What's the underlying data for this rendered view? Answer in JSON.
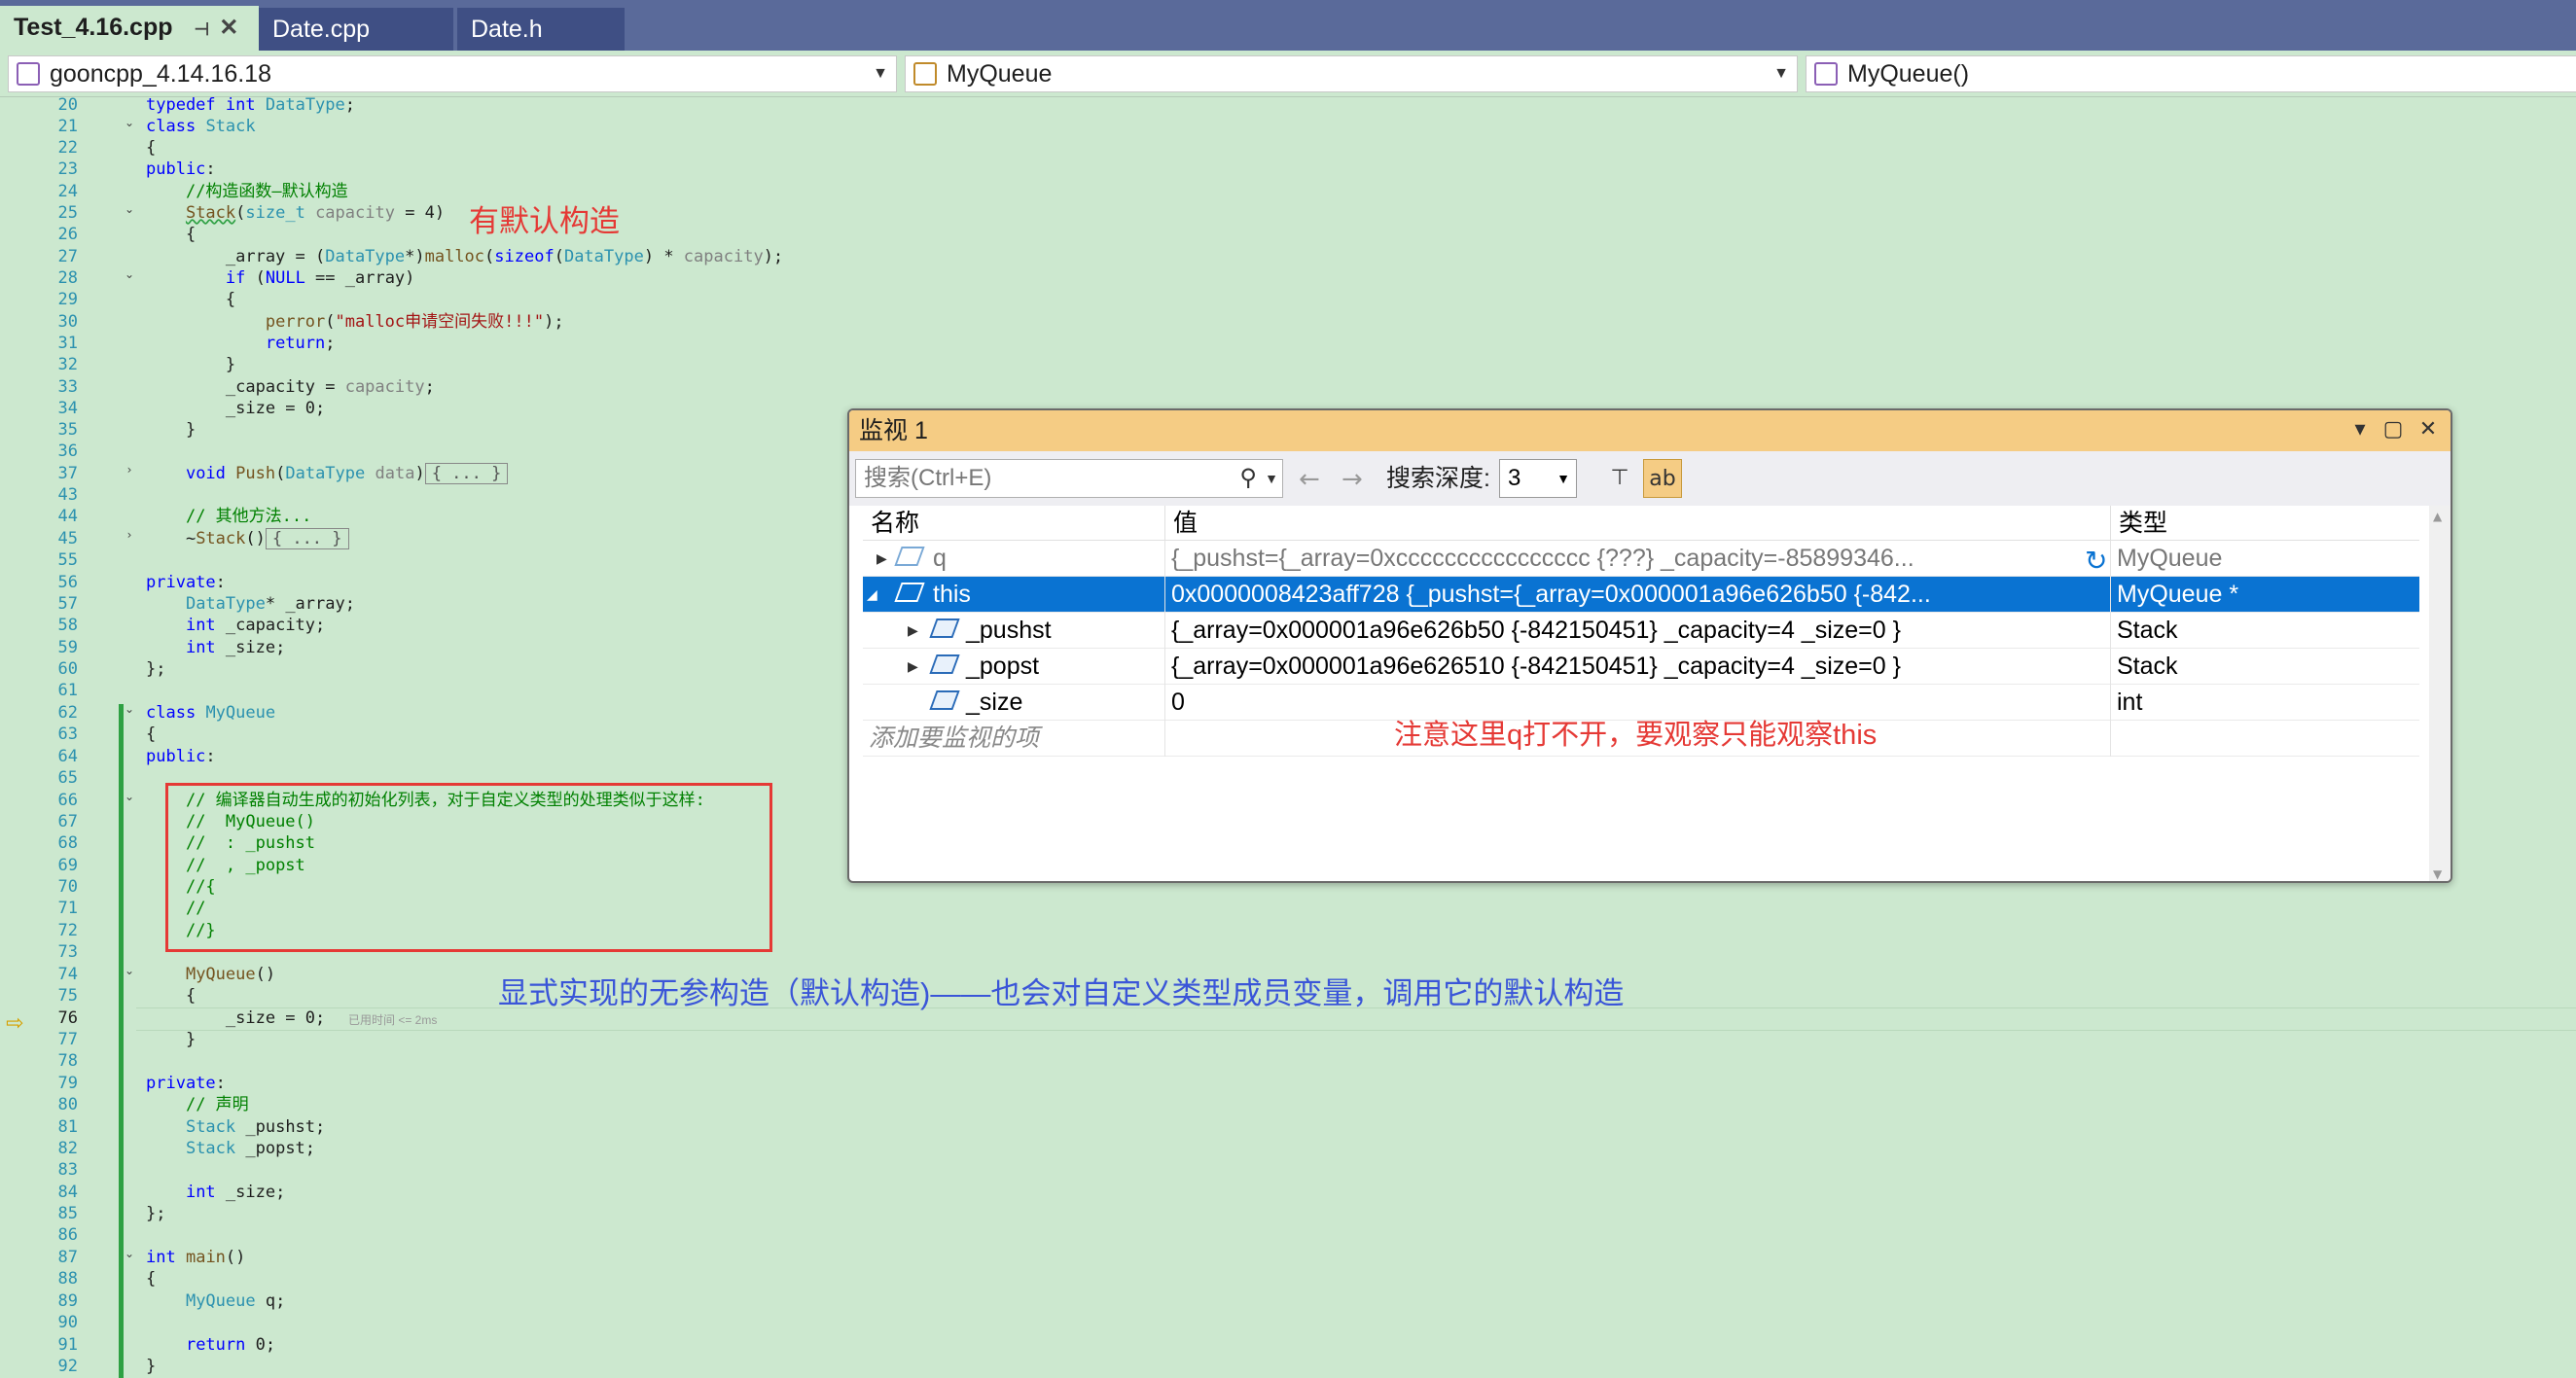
{
  "tabs": [
    {
      "label": "Test_4.16.cpp",
      "active": true
    },
    {
      "label": "Date.cpp"
    },
    {
      "label": "Date.h"
    }
  ],
  "nav": {
    "project": "gooncpp_4.14.16.18",
    "scope": "MyQueue",
    "member": "MyQueue()"
  },
  "editor": {
    "line_numbers": [
      "20",
      "21",
      "22",
      "23",
      "24",
      "25",
      "26",
      "27",
      "28",
      "29",
      "30",
      "31",
      "32",
      "33",
      "34",
      "35",
      "36",
      "37",
      "43",
      "44",
      "45",
      "55",
      "56",
      "57",
      "58",
      "59",
      "60",
      "61",
      "62",
      "63",
      "64",
      "65",
      "66",
      "67",
      "68",
      "69",
      "70",
      "71",
      "72",
      "73",
      "74",
      "75",
      "76",
      "77",
      "78",
      "79",
      "80",
      "81",
      "82",
      "83",
      "84",
      "85",
      "86",
      "87",
      "88",
      "89",
      "90",
      "91",
      "92"
    ],
    "current_line": "76",
    "perf_hint": "已用时间 <= 2ms",
    "collapsed_body": "{ ... }"
  },
  "annotations": {
    "default_ctor": "有默认构造",
    "explicit_ctor": "显式实现的无参构造（默认构造)——也会对自定义类型成员变量，调用它的默认构造",
    "watch_note": "注意这里q打不开，要观察只能观察this"
  },
  "watch": {
    "title": "监视 1",
    "search_placeholder": "搜索(Ctrl+E)",
    "depth_label": "搜索深度:",
    "depth_value": "3",
    "columns": {
      "name": "名称",
      "value": "值",
      "type": "类型"
    },
    "rows": [
      {
        "name": "q",
        "value": "{_pushst={_array=0xcccccccccccccccc {???} _capacity=-85899346...",
        "type": "MyQueue"
      },
      {
        "name": "this",
        "value": "0x0000008423aff728 {_pushst={_array=0x000001a96e626b50 {-842...",
        "type": "MyQueue *"
      },
      {
        "name": "_pushst",
        "value": "{_array=0x000001a96e626b50 {-842150451} _capacity=4 _size=0 }",
        "type": "Stack"
      },
      {
        "name": "_popst",
        "value": "{_array=0x000001a96e626510 {-842150451} _capacity=4 _size=0 }",
        "type": "Stack"
      },
      {
        "name": "_size",
        "value": "0",
        "type": "int"
      }
    ],
    "add_item": "添加要监视的项"
  }
}
